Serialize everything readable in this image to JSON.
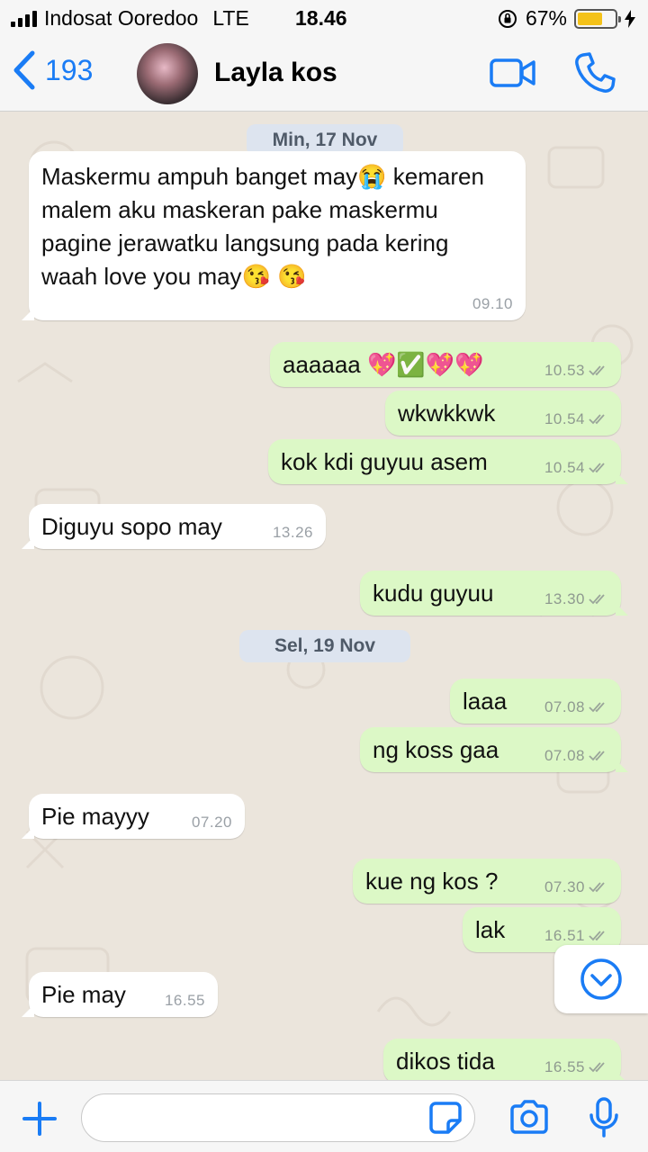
{
  "status_bar": {
    "carrier": "Indosat Ooredoo",
    "network": "LTE",
    "time": "18.46",
    "battery": "67%",
    "battery_level": 0.67
  },
  "header": {
    "back_count": "193",
    "contact_name": "Layla kos",
    "icons": [
      "chevron-left-icon",
      "video-call-icon",
      "phone-call-icon"
    ]
  },
  "dates": [
    "Min, 17 Nov",
    "Sel, 19 Nov"
  ],
  "messages": [
    {
      "dir": "in",
      "text": "Maskermu ampuh banget may😭 kemaren malem aku maskeran pake maskermu pagine jerawatku langsung pada kering waah love you may😘 😘",
      "time": "09.10"
    },
    {
      "dir": "out",
      "text": "aaaaaa 💖✅💖💖",
      "time": "10.53"
    },
    {
      "dir": "out",
      "text": "wkwkkwk",
      "time": "10.54"
    },
    {
      "dir": "out",
      "text": "kok kdi guyuu asem",
      "time": "10.54"
    },
    {
      "dir": "in",
      "text": "Diguyu sopo may",
      "time": "13.26"
    },
    {
      "dir": "out",
      "text": "kudu guyuu",
      "time": "13.30"
    },
    {
      "dir": "out",
      "text": "laaa",
      "time": "07.08"
    },
    {
      "dir": "out",
      "text": "ng koss gaa",
      "time": "07.08"
    },
    {
      "dir": "in",
      "text": "Pie mayyy",
      "time": "07.20"
    },
    {
      "dir": "out",
      "text": "kue ng kos ?",
      "time": "07.30"
    },
    {
      "dir": "out",
      "text": "lak",
      "time": "16.51"
    },
    {
      "dir": "in",
      "text": "Pie may",
      "time": "16.55"
    },
    {
      "dir": "out",
      "text": "dikos tida",
      "time": "16.55"
    }
  ],
  "input": {
    "placeholder": "",
    "value": ""
  },
  "colors": {
    "accent": "#1a7cf5",
    "outgoing_bubble": "#dcf8c6",
    "incoming_bubble": "#ffffff",
    "chat_background": "#ebe5dc",
    "date_chip": "#dde4ef"
  }
}
